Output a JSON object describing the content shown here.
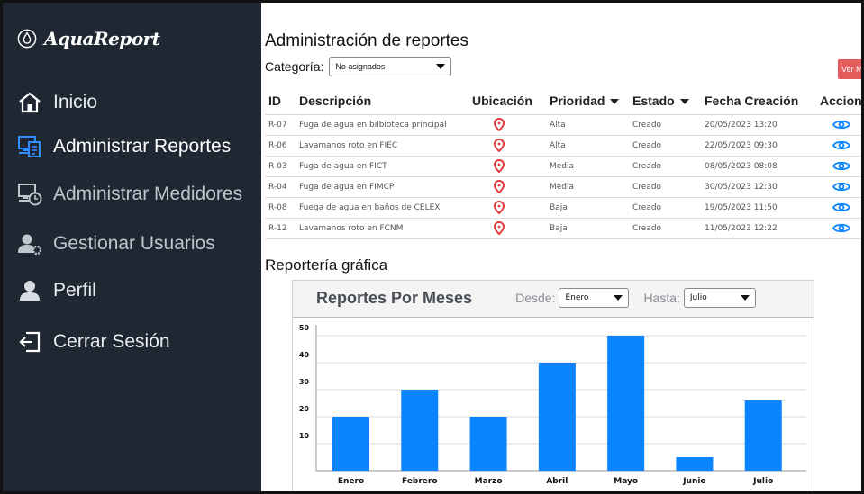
{
  "app": {
    "name": "AquaReport"
  },
  "sidebar": {
    "items": [
      {
        "label": "Inicio",
        "icon": "home-icon"
      },
      {
        "label": "Administrar Reportes",
        "icon": "report-document-icon"
      },
      {
        "label": "Administrar Medidores",
        "icon": "meter-clock-icon"
      },
      {
        "label": "Gestionar Usuarios",
        "icon": "users-gear-icon"
      },
      {
        "label": "Perfil",
        "icon": "user-icon"
      },
      {
        "label": "Cerrar Sesión",
        "icon": "logout-icon"
      }
    ]
  },
  "main": {
    "title": "Administración de reportes",
    "category_label": "Categoría:",
    "category_value": "No asignados",
    "map_button": "Ver Mapa",
    "table": {
      "headers": [
        "ID",
        "Descripción",
        "Ubicación",
        "Prioridad",
        "Estado",
        "Fecha Creación",
        "Acciones"
      ],
      "rows": [
        {
          "id": "R-07",
          "desc": "Fuga de agua en bilbioteca principal",
          "priority": "Alta",
          "status": "Creado",
          "date": "20/05/2023 13:20"
        },
        {
          "id": "R-06",
          "desc": "Lavamanos roto en FIEC",
          "priority": "Alta",
          "status": "Creado",
          "date": "22/05/2023 09:30"
        },
        {
          "id": "R-03",
          "desc": "Fuga de agua en FICT",
          "priority": "Media",
          "status": "Creado",
          "date": "08/05/2023 08:08"
        },
        {
          "id": "R-04",
          "desc": "Fuga de agua en FIMCP",
          "priority": "Media",
          "status": "Creado",
          "date": "30/05/2023 12:30"
        },
        {
          "id": "R-08",
          "desc": "Fuega de agua en baños de CELEX",
          "priority": "Baja",
          "status": "Creado",
          "date": "19/05/2023 11:50"
        },
        {
          "id": "R-12",
          "desc": "Lavamanos roto en FCNM",
          "priority": "Baja",
          "status": "Creado",
          "date": "11/05/2023 12:22"
        }
      ]
    },
    "graph_section_title": "Reportería gráfica",
    "chart_panel": {
      "title": "Reportes Por Meses",
      "from_label": "Desde:",
      "from_value": "Enero",
      "to_label": "Hasta:",
      "to_value": "Julio"
    }
  },
  "colors": {
    "sidebar_bg": "#1f2733",
    "accent_blue": "#0a84ff",
    "pin_red": "#e23b3b",
    "map_button": "#e45b5b"
  },
  "chart_data": {
    "type": "bar",
    "categories": [
      "Enero",
      "Febrero",
      "Marzo",
      "Abril",
      "Mayo",
      "Junio",
      "Julio"
    ],
    "values": [
      20,
      30,
      20,
      40,
      50,
      5,
      26
    ],
    "yticks": [
      10,
      20,
      30,
      40,
      50
    ],
    "ylim": [
      0,
      54
    ],
    "grid": true,
    "color": "#0a84ff"
  }
}
